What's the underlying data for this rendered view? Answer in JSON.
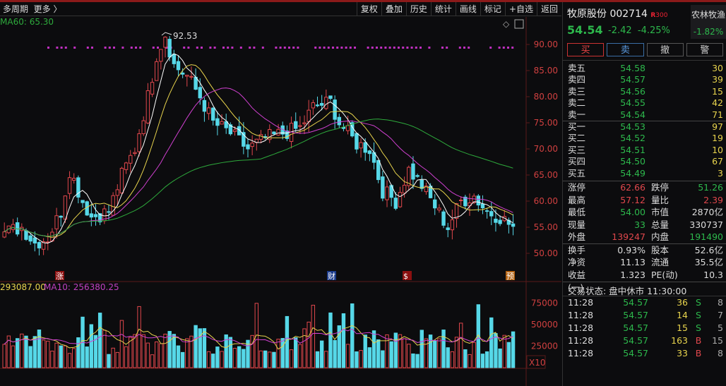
{
  "toolbar": {
    "period": "多周期",
    "more": "更多 〉",
    "buttons": [
      "复权",
      "叠加",
      "历史",
      "统计",
      "画线",
      "标记",
      "+自选",
      "返回"
    ]
  },
  "chart": {
    "ma60_label": "MA60: 65.30",
    "high_label": "92.53",
    "price_ticks": [
      "90.00",
      "85.00",
      "80.00",
      "75.00",
      "70.00",
      "65.00",
      "60.00",
      "55.00",
      "50.00"
    ],
    "vol_label_a": "293087.00",
    "vol_label_b": "MA10: 256380.25",
    "vol_ticks": [
      "75000",
      "50000",
      "25000"
    ],
    "vol_unit": "X10",
    "markers": [
      "涨",
      "财",
      "$",
      "预"
    ]
  },
  "chart_data": {
    "type": "candlestick",
    "ylim": [
      48,
      94
    ],
    "vol_ylim": [
      0,
      90000
    ],
    "price_path": [
      [
        0,
        54
      ],
      [
        4,
        55
      ],
      [
        7,
        52
      ],
      [
        10,
        53
      ],
      [
        13,
        58
      ],
      [
        15,
        66
      ],
      [
        18,
        60
      ],
      [
        20,
        57
      ],
      [
        24,
        58
      ],
      [
        27,
        65
      ],
      [
        30,
        70
      ],
      [
        33,
        80
      ],
      [
        35,
        88
      ],
      [
        37,
        92
      ],
      [
        39,
        86
      ],
      [
        42,
        84
      ],
      [
        45,
        80
      ],
      [
        48,
        75
      ],
      [
        52,
        73
      ],
      [
        56,
        70
      ],
      [
        60,
        72
      ],
      [
        64,
        73
      ],
      [
        68,
        74
      ],
      [
        71,
        78
      ],
      [
        75,
        79
      ],
      [
        77,
        75
      ],
      [
        81,
        71
      ],
      [
        84,
        70
      ],
      [
        87,
        62
      ],
      [
        90,
        60
      ],
      [
        93,
        66
      ],
      [
        96,
        63
      ],
      [
        99,
        59
      ],
      [
        102,
        55
      ],
      [
        105,
        60
      ],
      [
        108,
        61
      ],
      [
        111,
        58
      ],
      [
        114,
        57
      ],
      [
        117,
        55
      ]
    ],
    "colors": {
      "up": "#e0474c",
      "down": "#56d8e8",
      "ma5": "#ffffff",
      "ma10": "#e8d44d",
      "ma20": "#d040d0",
      "ma60": "#2eaa3c"
    }
  },
  "quote": {
    "name": "牧原股份 002714",
    "badge": "R",
    "badge2": "300",
    "sector": "农林牧渔",
    "sector_pct": "-1.82%",
    "price": "54.54",
    "chg": "-2.42",
    "pct": "-4.25%"
  },
  "actions": [
    "买",
    "卖",
    "撤",
    "警"
  ],
  "asks": [
    [
      "卖五",
      "54.58",
      "30"
    ],
    [
      "卖四",
      "54.57",
      "39"
    ],
    [
      "卖三",
      "54.56",
      "15"
    ],
    [
      "卖二",
      "54.55",
      "42"
    ],
    [
      "卖一",
      "54.54",
      "71"
    ]
  ],
  "bids": [
    [
      "买一",
      "54.53",
      "97"
    ],
    [
      "买二",
      "54.52",
      "19"
    ],
    [
      "买三",
      "54.51",
      "10"
    ],
    [
      "买四",
      "54.50",
      "67"
    ],
    [
      "买五",
      "54.49",
      "3"
    ]
  ],
  "stats1": [
    [
      "涨停",
      "62.66",
      "跌停",
      "51.26"
    ],
    [
      "最高",
      "57.12",
      "量比",
      "2.39"
    ],
    [
      "最低",
      "54.00",
      "市值",
      "2870亿"
    ],
    [
      "现量",
      "33",
      "总量",
      "330737"
    ],
    [
      "外盘",
      "139247",
      "内盘",
      "191490"
    ]
  ],
  "stats2": [
    [
      "换手",
      "0.93%",
      "股本",
      "52.6亿"
    ],
    [
      "净资",
      "11.13",
      "流通",
      "35.5亿"
    ],
    [
      "收益(一)",
      "1.323",
      "PE(动)",
      "10.3"
    ]
  ],
  "status": "交易状态: 盘中休市 11:30:00",
  "ticks": [
    [
      "11:28",
      "54.57",
      "36",
      "S",
      "8"
    ],
    [
      "11:28",
      "54.57",
      "14",
      "S",
      "7"
    ],
    [
      "11:28",
      "54.57",
      "15",
      "S",
      "5"
    ],
    [
      "11:28",
      "54.57",
      "163",
      "B",
      "15"
    ],
    [
      "11:28",
      "54.57",
      "33",
      "B",
      "8"
    ]
  ]
}
